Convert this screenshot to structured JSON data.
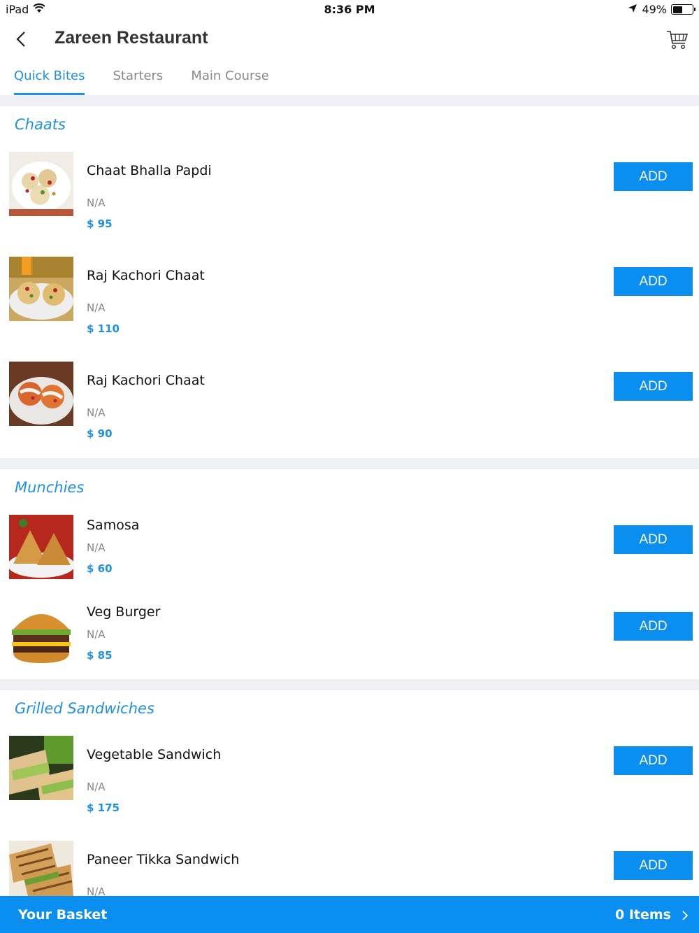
{
  "status_bar": {
    "device": "iPad",
    "time": "8:36 PM",
    "battery": "49%",
    "battery_level": 0.49
  },
  "header": {
    "title": "Zareen Restaurant",
    "back_icon": "chevron-left-icon",
    "cart_icon": "cart-icon"
  },
  "tabs": [
    {
      "label": "Quick Bites",
      "active": true
    },
    {
      "label": "Starters",
      "active": false
    },
    {
      "label": "Main Course",
      "active": false
    }
  ],
  "sections": [
    {
      "title": "Chaats",
      "items": [
        {
          "name": "Chaat Bhalla Papdi",
          "desc": "N/A",
          "price": "$ 95",
          "button": "ADD"
        },
        {
          "name": "Raj Kachori Chaat",
          "desc": "N/A",
          "price": "$ 110",
          "button": "ADD"
        },
        {
          "name": "Raj Kachori Chaat",
          "desc": "N/A",
          "price": "$ 90",
          "button": "ADD"
        }
      ]
    },
    {
      "title": "Munchies",
      "items": [
        {
          "name": "Samosa",
          "desc": "N/A",
          "price": "$ 60",
          "button": "ADD"
        },
        {
          "name": "Veg Burger",
          "desc": "N/A",
          "price": "$ 85",
          "button": "ADD"
        }
      ]
    },
    {
      "title": "Grilled Sandwiches",
      "items": [
        {
          "name": "Vegetable Sandwich",
          "desc": "N/A",
          "price": "$ 175",
          "button": "ADD"
        },
        {
          "name": "Paneer Tikka Sandwich",
          "desc": "N/A",
          "price": "",
          "button": "ADD"
        }
      ]
    }
  ],
  "basket": {
    "label": "Your Basket",
    "count": "0 Items"
  },
  "colors": {
    "accent": "#1e90e8",
    "button": "#0a8ef0",
    "divider": "#eff0f3"
  }
}
